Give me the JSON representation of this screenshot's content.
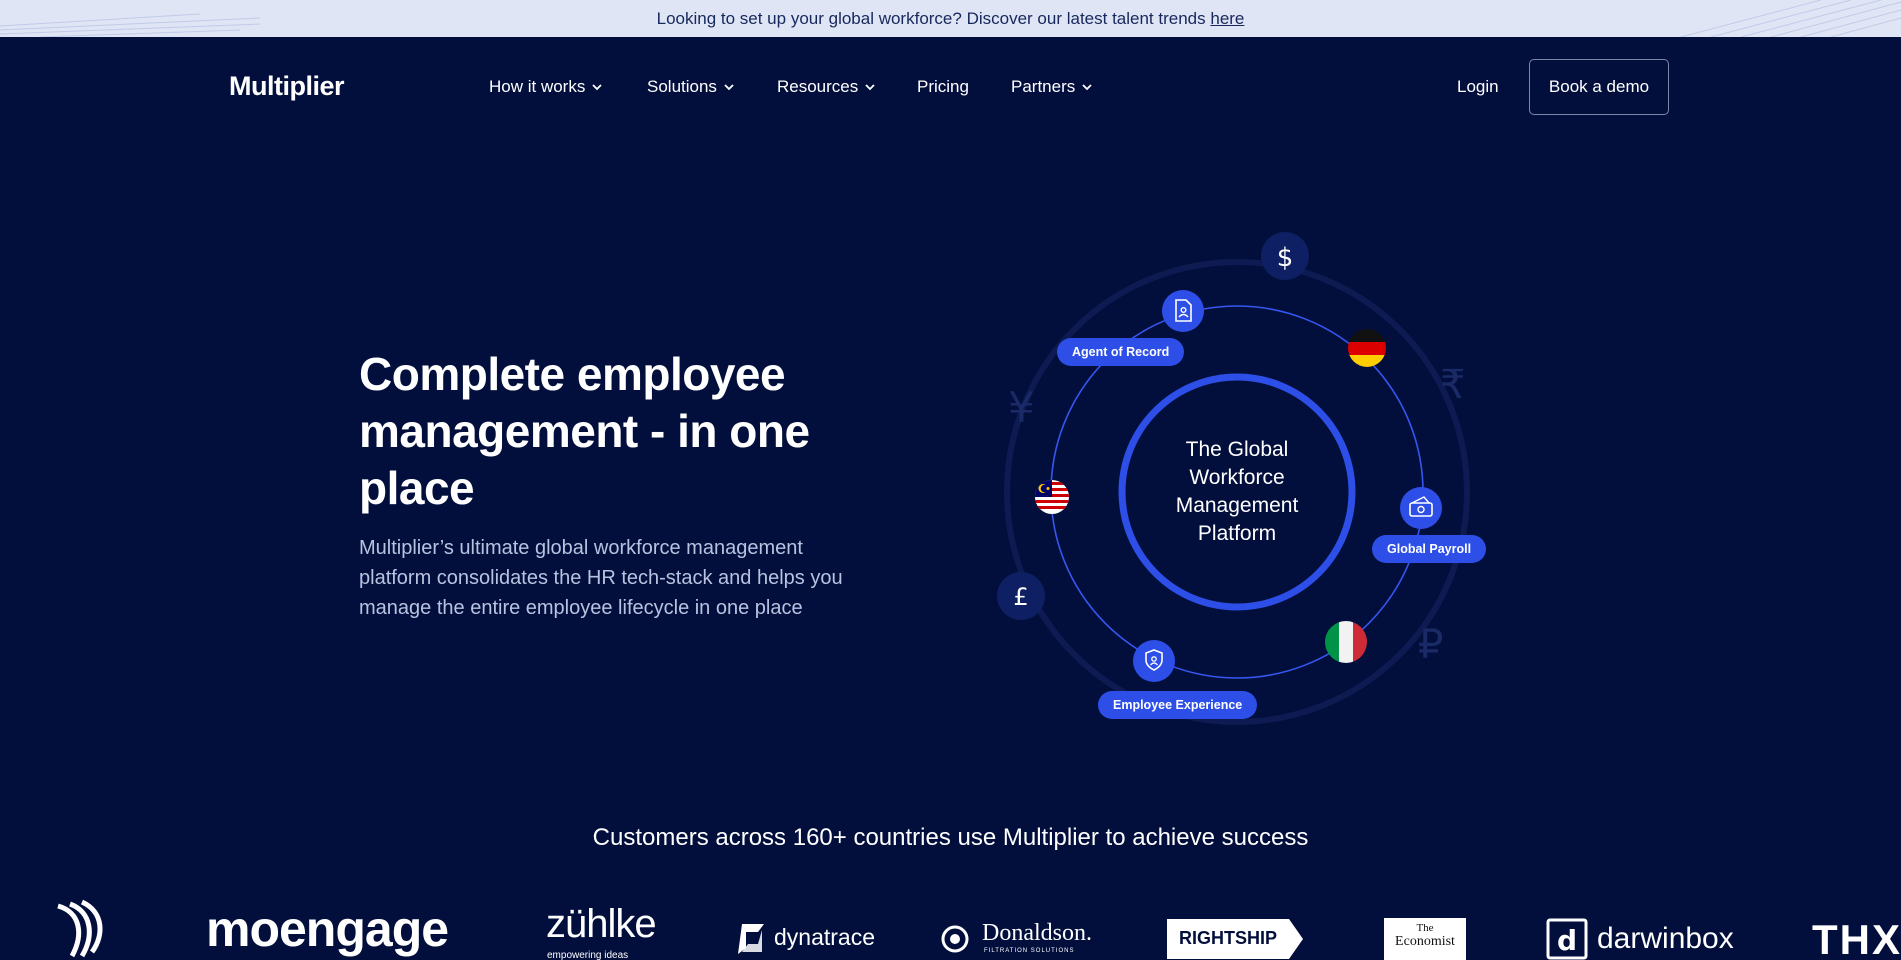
{
  "announcement": {
    "text": "Looking to set up your global workforce? Discover our latest talent trends",
    "link_text": "here"
  },
  "nav": {
    "logo": "Multiplier",
    "menu": [
      {
        "label": "How it works",
        "has_dropdown": true
      },
      {
        "label": "Solutions",
        "has_dropdown": true
      },
      {
        "label": "Resources",
        "has_dropdown": true
      },
      {
        "label": "Pricing",
        "has_dropdown": false
      },
      {
        "label": "Partners",
        "has_dropdown": true
      }
    ],
    "login": "Login",
    "demo": "Book a demo"
  },
  "hero": {
    "title": "Complete employee management - in one place",
    "subtitle": "Multiplier’s ultimate global workforce management platform consolidates the HR tech-stack and helps you manage the entire employee lifecycle in one place"
  },
  "diagram": {
    "center_text": "The Global Workforce Management Platform",
    "labels": {
      "agent": "Agent of Record",
      "payroll": "Global Payroll",
      "experience": "Employee Experience"
    },
    "currency_symbols": {
      "dollar": "$",
      "pound": "£",
      "yen": "¥",
      "rupee": "₹",
      "ruble": "₽"
    },
    "flags": [
      "germany-flag",
      "malaysia-flag",
      "italy-flag"
    ],
    "colors": {
      "accent": "#2d4fe8",
      "ring": "#3656f0",
      "background": "#020f3c"
    }
  },
  "customers": {
    "heading": "Customers across 160+ countries use Multiplier to achieve success",
    "logos": {
      "moengage": "moengage",
      "zuhlke": "zühlke",
      "zuhlke_tag": "empowering ideas",
      "dynatrace": "dynatrace",
      "donaldson": "Donaldson.",
      "donaldson_tag": "FILTRATION SOLUTIONS",
      "rightship": "RIGHTSHIP",
      "economist_the": "The",
      "economist": "Economist",
      "darwinbox": "darwinbox",
      "thx": "THX"
    }
  }
}
